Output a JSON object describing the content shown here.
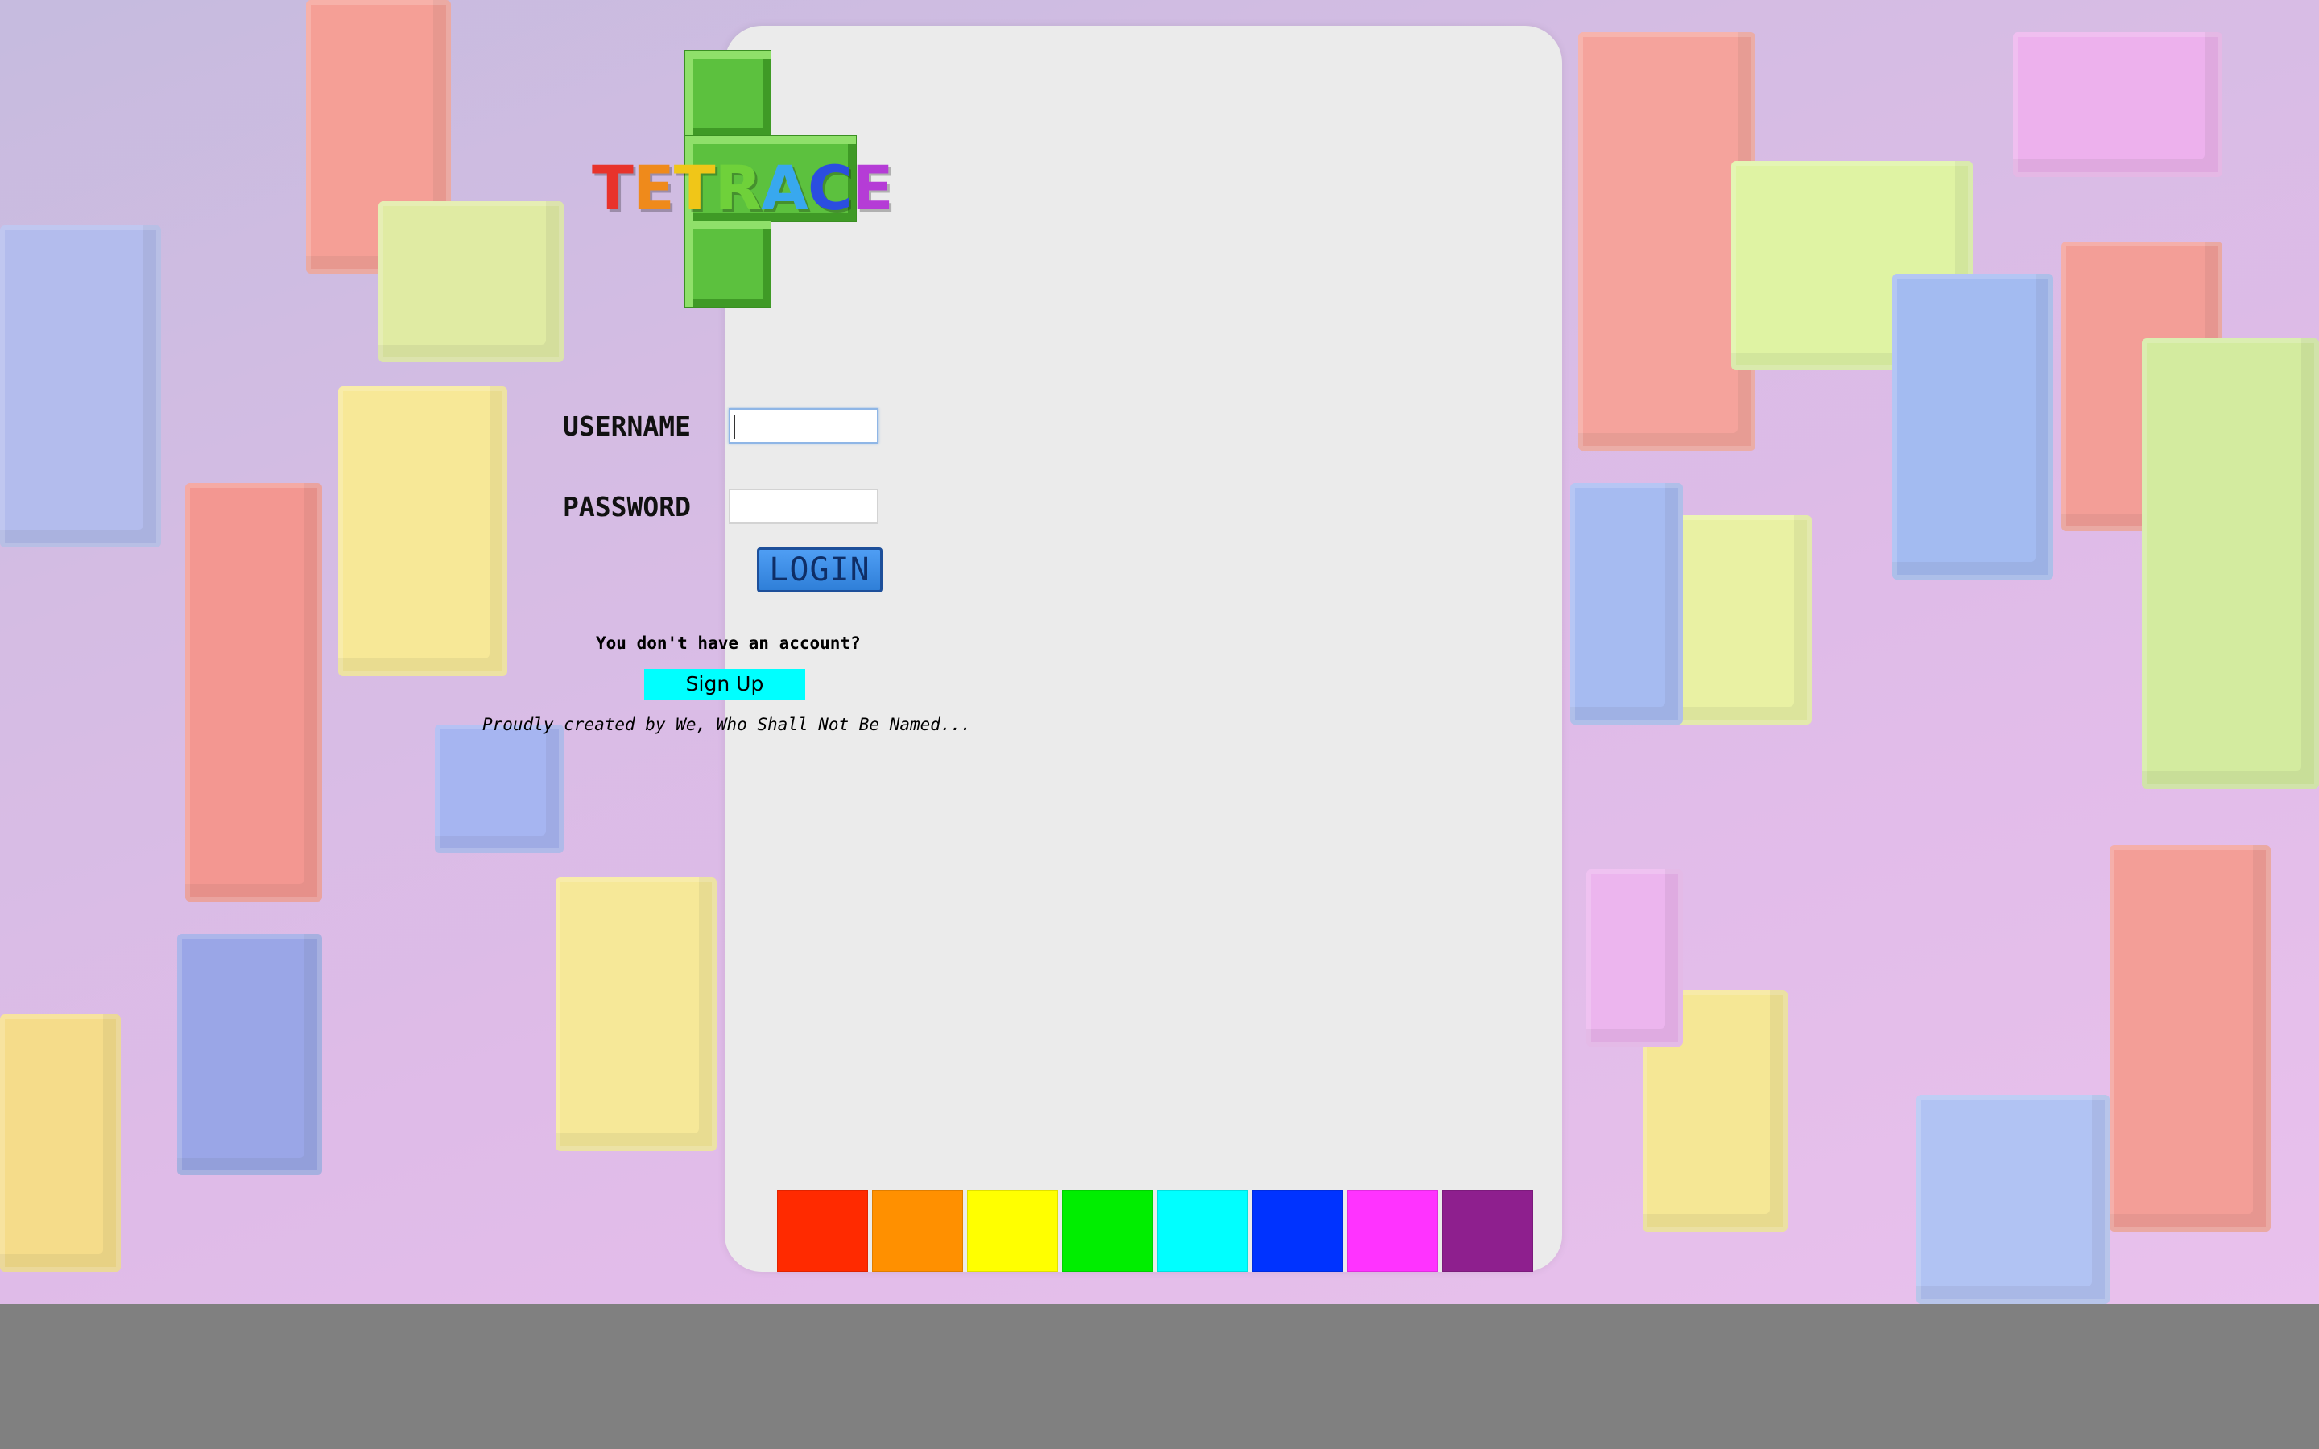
{
  "logo": {
    "letters": [
      "T",
      "E",
      "T",
      "R",
      "A",
      "C",
      "E"
    ],
    "colors": [
      "#e8332b",
      "#ef8a1b",
      "#f0c618",
      "#6fd13a",
      "#38a8ef",
      "#2b4ee0",
      "#b53cd6"
    ]
  },
  "login": {
    "username_label": "USERNAME",
    "username_value": "",
    "password_label": "PASSWORD",
    "password_value": "",
    "login_button": "LOGIN"
  },
  "signup": {
    "question": "You don't have an account?",
    "button": "Sign Up"
  },
  "credits": "Proudly created by We, Who Shall Not Be Named...",
  "palette": [
    "#ff2a00",
    "#ff9000",
    "#ffff00",
    "#00ee00",
    "#00ffff",
    "#0033ff",
    "#ff33ff",
    "#8e1f8e"
  ]
}
